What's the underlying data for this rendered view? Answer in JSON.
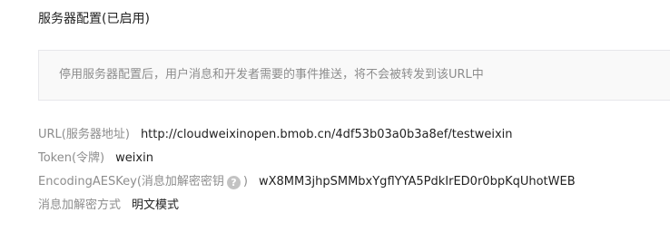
{
  "section": {
    "title": "服务器配置(已启用)"
  },
  "notice": {
    "text": "停用服务器配置后，用户消息和开发者需要的事件推送，将不会被转发到该URL中"
  },
  "config": {
    "url_label": "URL(服务器地址)",
    "url_value": "http://cloudweixinopen.bmob.cn/4df53b03a0b3a8ef/testweixin",
    "token_label": "Token(令牌)",
    "token_value": "weixin",
    "aes_label": "EncodingAESKey(消息加解密密钥",
    "aes_help_icon": "?",
    "aes_label_close": ")",
    "aes_value": "wX8MM3jhpSMMbxYgflYYA5PdkIrED0r0bpKqUhotWEB",
    "mode_label": "消息加解密方式",
    "mode_value": "明文模式"
  }
}
